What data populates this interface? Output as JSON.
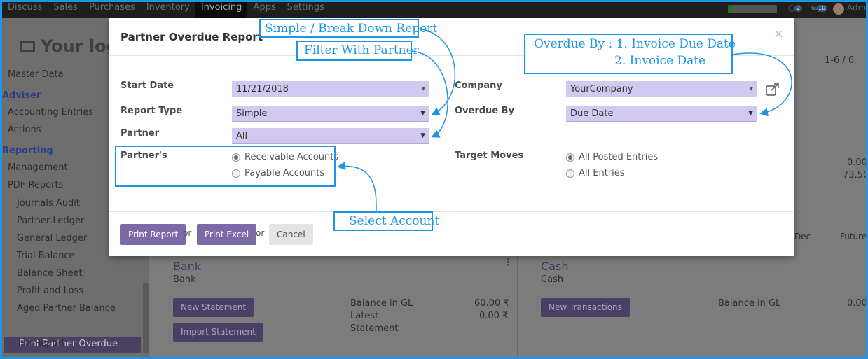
{
  "topbar": {
    "menu": [
      "Discuss",
      "Sales",
      "Purchases",
      "Inventory",
      "Invoicing",
      "Apps",
      "Settings"
    ],
    "active": "Invoicing",
    "progress_fraction": 0.1,
    "messages_count": "2",
    "activities_count": "10",
    "user": "Adm"
  },
  "sidebar": {
    "logo_text": "Your log",
    "items": {
      "master_data": "Master Data",
      "adviser": "Adviser",
      "accounting_entries": "Accounting Entries",
      "actions": "Actions",
      "reporting": "Reporting",
      "management": "Management",
      "pdf_reports": "PDF Reports",
      "journals_audit": "Journals Audit",
      "partner_ledger": "Partner Ledger",
      "general_ledger": "General Ledger",
      "trial_balance": "Trial Balance",
      "balance_sheet": "Balance Sheet",
      "profit_and_loss": "Profit and Loss",
      "aged_partner_balance": "Aged Partner Balance",
      "print_partner_overdue": "Print Partner Overdue",
      "tax_report": "Tax Report"
    }
  },
  "background": {
    "pager": "1-6 / 6",
    "value1": "0.00",
    "value2": "73.50",
    "col_dec": "Dec",
    "col_future": "Future",
    "bank": {
      "title": "Bank",
      "subtitle": "Bank",
      "new_statement": "New Statement",
      "import_statement": "Import Statement",
      "balance_gl_label": "Balance in GL",
      "balance_gl_value": "60.00 ₹",
      "latest_label_1": "Latest",
      "latest_label_2": "Statement",
      "latest_value": "0.00 ₹"
    },
    "cash": {
      "title": "Cash",
      "subtitle": "Cash",
      "new_transactions": "New Transactions",
      "balance_gl_label": "Balance in GL",
      "balance_gl_value": "0.00"
    }
  },
  "modal": {
    "title": "Partner Overdue Report",
    "close": "×",
    "start_date_label": "Start Date",
    "start_date_value": "11/21/2018",
    "report_type_label": "Report Type",
    "report_type_value": "Simple",
    "partner_label": "Partner",
    "partner_value": "All",
    "partners_label": "Partner's",
    "partners_options": [
      "Receivable Accounts",
      "Payable Accounts"
    ],
    "partners_selected": "Receivable Accounts",
    "company_label": "Company",
    "company_value": "YourCompany",
    "overdue_by_label": "Overdue By",
    "overdue_by_value": "Due Date",
    "target_moves_label": "Target Moves",
    "target_moves_options": [
      "All Posted Entries",
      "All Entries"
    ],
    "target_moves_selected": "All Posted Entries",
    "buttons": {
      "print_report": "Print Report",
      "or1": "or",
      "print_excel": "Print Excel",
      "or2": "or",
      "cancel": "Cancel"
    }
  },
  "callouts": {
    "simple_breakdown": "Simple / Break Down Report",
    "filter_partner": "Filter With Partner",
    "overdue_line1": "Overdue By : 1. Invoice Due Date",
    "overdue_line2": "2. Invoice Date",
    "select_account": "Select Account"
  },
  "colors": {
    "accent": "#7c6aa8",
    "select_bg": "#d2c9f1",
    "annotation": "#1d96e6",
    "navbar": "#1f1f1f"
  }
}
